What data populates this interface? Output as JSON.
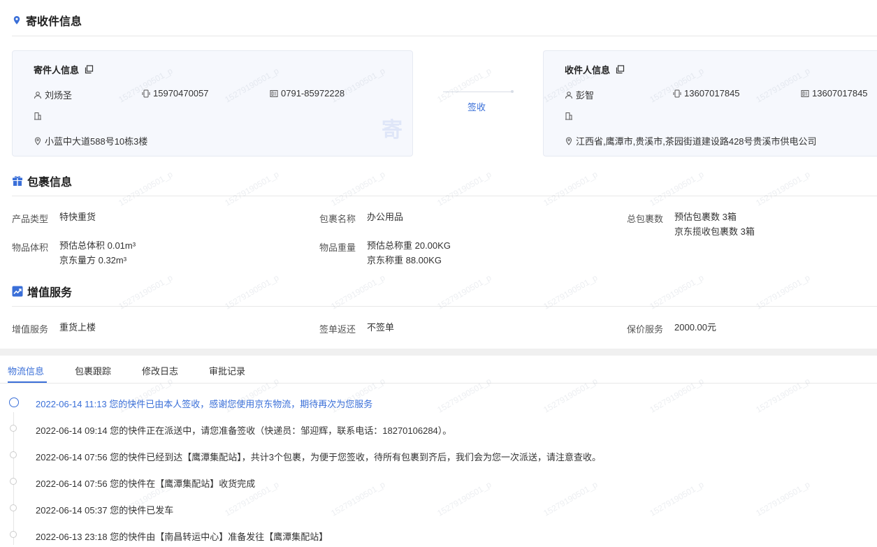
{
  "header": {
    "title": "寄收件信息"
  },
  "sender": {
    "title": "寄件人信息",
    "name": "刘炀圣",
    "mobile": "15970470057",
    "phone": "0791-85972228",
    "address": "小蓝中大道588号10栋3楼",
    "stamp": "寄"
  },
  "middle": {
    "status": "签收"
  },
  "receiver": {
    "title": "收件人信息",
    "name": "彭智",
    "mobile": "13607017845",
    "phone": "13607017845",
    "address": "江西省,鹰潭市,贵溪市,茶园街道建设路428号贵溪市供电公司"
  },
  "package": {
    "title": "包裹信息",
    "product_type_label": "产品类型",
    "product_type": "特快重货",
    "name_label": "包裹名称",
    "name": "办公用品",
    "count_label": "总包裹数",
    "count_estimated": "预估包裹数 3箱",
    "count_jd": "京东揽收包裹数 3箱",
    "volume_label": "物品体积",
    "volume_estimated": "预估总体积 0.01m³",
    "volume_jd": "京东量方 0.32m³",
    "weight_label": "物品重量",
    "weight_estimated": "预估总称重 20.00KG",
    "weight_jd": "京东称重 88.00KG"
  },
  "value_added": {
    "title": "增值服务",
    "service_label": "增值服务",
    "service": "重货上楼",
    "return_label": "签单返还",
    "return": "不签单",
    "insurance_label": "保价服务",
    "insurance": "2000.00元"
  },
  "tabs": [
    {
      "label": "物流信息",
      "active": true
    },
    {
      "label": "包裹跟踪"
    },
    {
      "label": "修改日志"
    },
    {
      "label": "审批记录"
    }
  ],
  "timeline": [
    "2022-06-14 11:13 您的快件已由本人签收，感谢您使用京东物流，期待再次为您服务",
    "2022-06-14 09:14 您的快件正在派送中，请您准备签收（快递员：邹迎辉，联系电话：18270106284）。",
    "2022-06-14 07:56 您的快件已经到达【鹰潭集配站】，共计3个包裹，为便于您签收，待所有包裹到齐后，我们会为您一次派送，请注意查收。",
    "2022-06-14 07:56 您的快件在【鹰潭集配站】收货完成",
    "2022-06-14 05:37 您的快件已发车",
    "2022-06-13 23:18 您的快件由【南昌转运中心】准备发往【鹰潭集配站】"
  ],
  "watermark_text": "15279190501_p",
  "colors": {
    "accent": "#3a6fd8",
    "card_bg": "#f6f8fd"
  }
}
